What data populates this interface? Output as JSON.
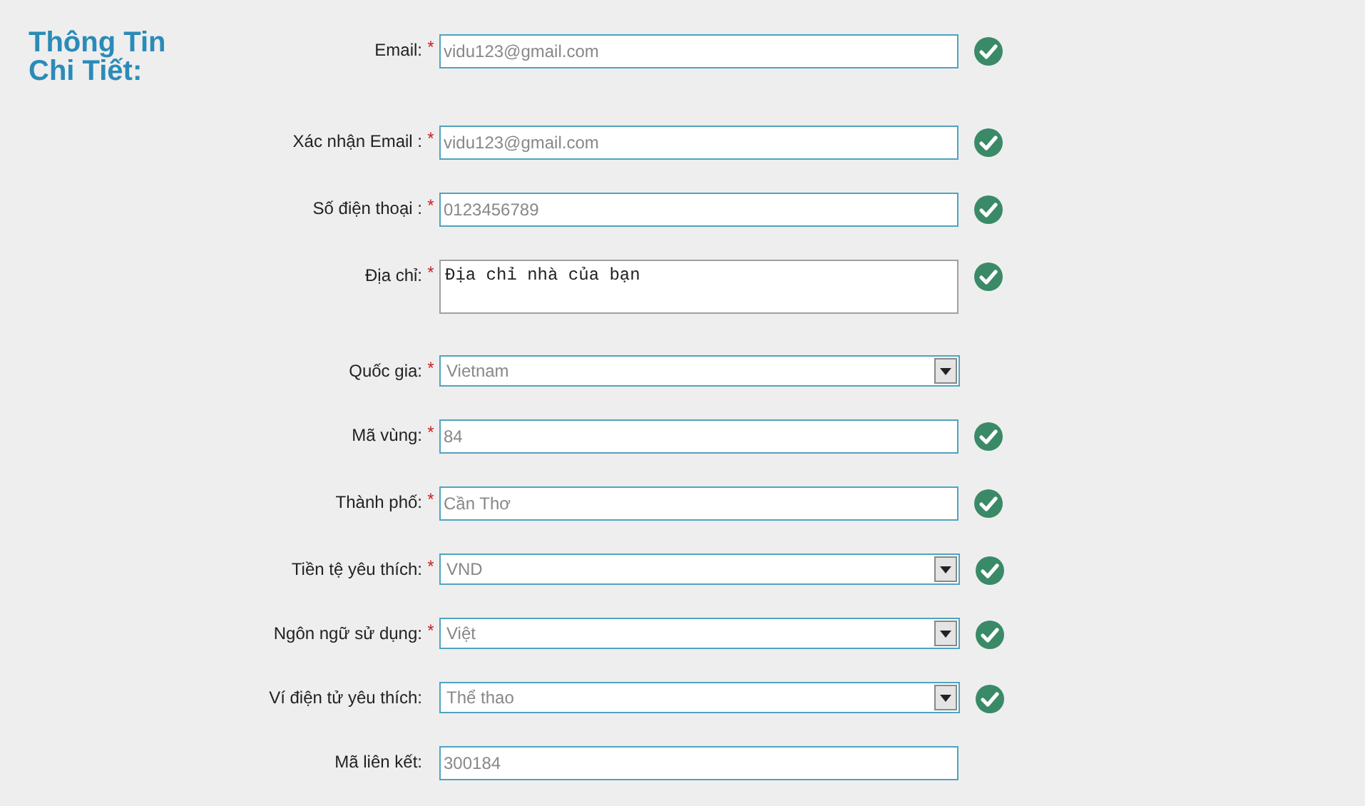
{
  "heading": "Thông Tin Chi Tiết:",
  "fields": [
    {
      "label": "Email:",
      "kind": "text",
      "marker": "*",
      "value": "vidu123@gmail.com",
      "valid": true
    },
    {
      "label": "Xác nhận Email :",
      "kind": "text",
      "marker": "*",
      "value": "vidu123@gmail.com",
      "valid": true
    },
    {
      "label": "Số điện thoại :",
      "kind": "text",
      "marker": "*",
      "value": "0123456789",
      "valid": true
    },
    {
      "label": "Địa chỉ:",
      "kind": "textarea",
      "marker": "*",
      "value": "Địa chỉ nhà của bạn",
      "valid": true
    },
    {
      "label": "Quốc gia:",
      "kind": "select",
      "marker": "*",
      "value": "Vietnam",
      "valid": false
    },
    {
      "label": "Mã vùng:",
      "kind": "text",
      "marker": "*",
      "value": "84",
      "valid": true
    },
    {
      "label": "Thành phố:",
      "kind": "text",
      "marker": "*",
      "value": "Cần Thơ",
      "valid": true
    },
    {
      "label": "Tiền tệ yêu thích:",
      "kind": "select",
      "marker": "*",
      "value": "VND",
      "valid": true
    },
    {
      "label": "Ngôn ngữ sử dụng:",
      "kind": "select",
      "marker": "*",
      "value": "Việt",
      "valid": true
    },
    {
      "label": "Ví điện tử yêu thích:",
      "kind": "select",
      "value": "Thể thao",
      "valid": true
    },
    {
      "label": "Mã liên kết:",
      "kind": "text",
      "value": "300184",
      "valid": false
    }
  ]
}
